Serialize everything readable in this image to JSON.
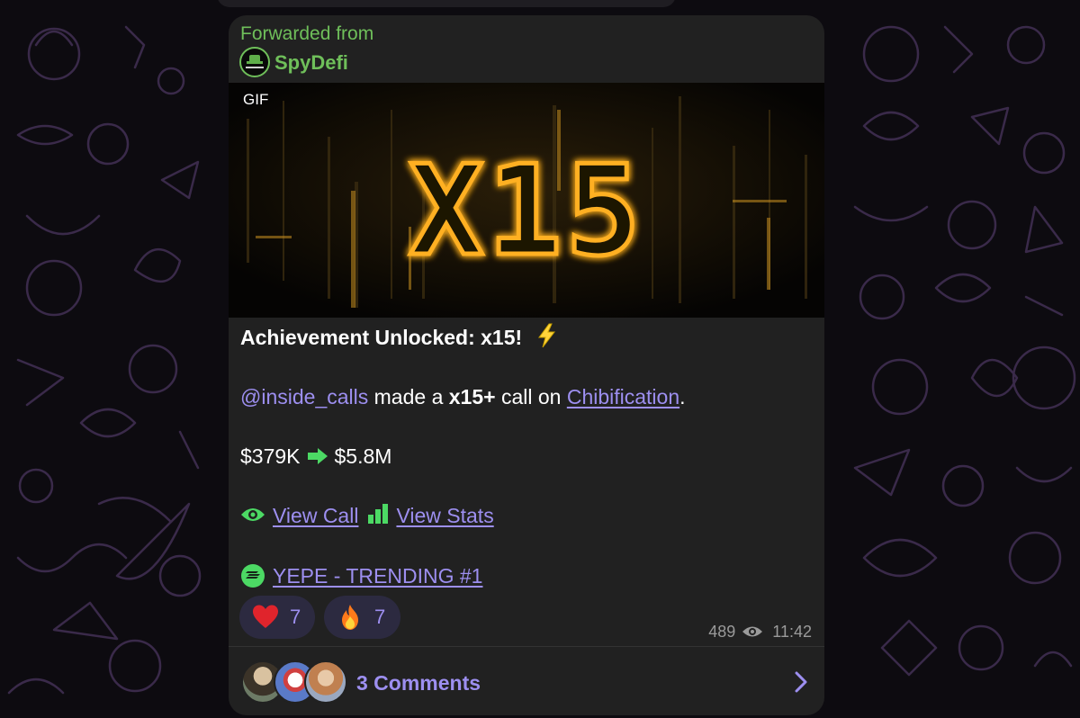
{
  "forward": {
    "label": "Forwarded from",
    "channel": "SpyDefi",
    "avatar_icon": "spy-hat-icon"
  },
  "media": {
    "badge": "GIF",
    "glow_text": "X15",
    "glow_color": "#ffb020"
  },
  "message": {
    "title": "Achievement Unlocked: x15!",
    "title_icon": "lightning-icon",
    "mention": "@inside_calls",
    "made_text": "made a",
    "multiplier": "x15+",
    "call_on_text": "call on",
    "token_link": "Chibification",
    "period": ".",
    "from_value": "$379K",
    "arrow_icon": "right-arrow-icon",
    "to_value": "$5.8M",
    "view_call": "View Call",
    "view_stats": "View Stats",
    "trending": "YEPE - TRENDING #1"
  },
  "reactions": [
    {
      "emoji": "heart-icon",
      "count": "7"
    },
    {
      "emoji": "fire-icon",
      "count": "7"
    }
  ],
  "meta": {
    "views": "489",
    "time": "11:42"
  },
  "comments": {
    "label": "3 Comments"
  },
  "colors": {
    "accent": "#9d8ff0",
    "forward_green": "#6fbf5a",
    "bubble": "#212121",
    "reaction_bg": "#2c2a40",
    "green_icon": "#4cd964"
  }
}
